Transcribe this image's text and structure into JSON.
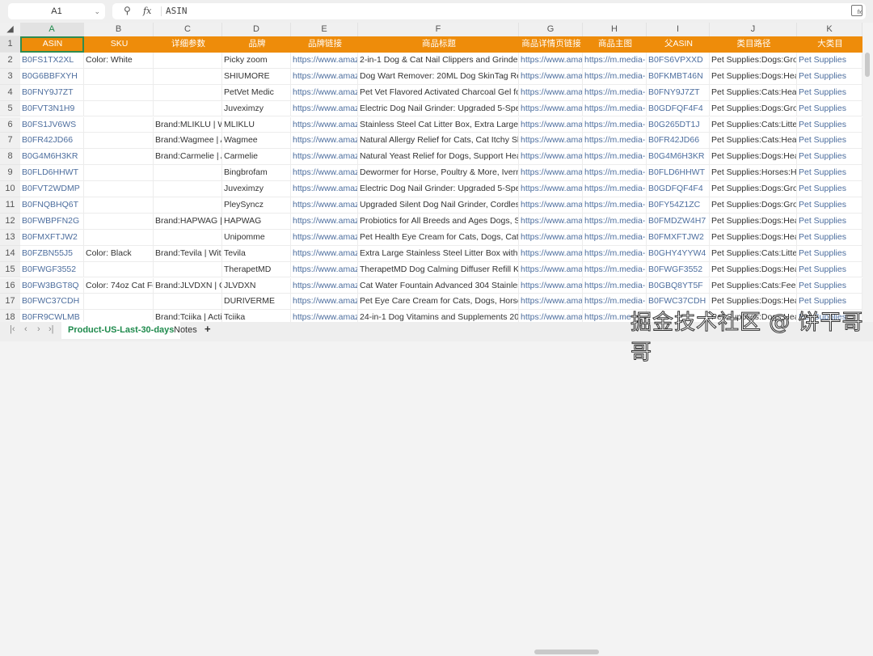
{
  "formula_bar": {
    "name_box": "A1",
    "formula": "ASIN"
  },
  "columns": [
    "A",
    "B",
    "C",
    "D",
    "E",
    "F",
    "G",
    "H",
    "I",
    "J",
    "K"
  ],
  "headers": [
    "ASIN",
    "SKU",
    "详细参数",
    "品牌",
    "品牌链接",
    "商品标题",
    "商品详情页链接",
    "商品主图",
    "父ASIN",
    "类目路径",
    "大类目"
  ],
  "rows": [
    [
      "B0FS1TX2XL",
      "Color: White",
      "",
      "Picky zoom",
      "https://www.amazc",
      "2-in-1 Dog & Cat Nail Clippers and Grinder \\",
      "https://www.ama:",
      "https://m.media-:",
      "B0FS6VPXXD",
      "Pet Supplies:Dogs:Groor",
      "Pet Supplies"
    ],
    [
      "B0G6BBFXYH",
      "",
      "",
      "SHIUMORE",
      "https://www.amazc",
      "Dog Wart Remover: 20ML Dog SkinTag Rem",
      "https://www.ama:",
      "https://m.media-:",
      "B0FKMBT46N",
      "Pet Supplies:Dogs:Healtl",
      "Pet Supplies"
    ],
    [
      "B0FNY9J7ZT",
      "",
      "",
      "PetVet Medic",
      "https://www.amazc",
      "Pet Vet Flavored Activated Charcoal Gel for D",
      "https://www.ama:",
      "https://m.media-:",
      "B0FNY9J7ZT",
      "Pet Supplies:Cats:Health",
      "Pet Supplies"
    ],
    [
      "B0FVT3N1H9",
      "",
      "",
      "Juveximzy",
      "https://www.amazc",
      "Electric Dog Nail Grinder: Upgraded 5-Speec",
      "https://www.ama:",
      "https://m.media-:",
      "B0GDFQF4F4",
      "Pet Supplies:Dogs:Groor",
      "Pet Supplies"
    ],
    [
      "B0FS1JV6WS",
      "",
      "Brand:MLIKLU | Wit",
      "MLIKLU",
      "https://www.amazc",
      "Stainless Steel Cat Litter Box, Extra Large Enc",
      "https://www.ama:",
      "https://m.media-:",
      "B0G265DT1J",
      "Pet Supplies:Cats:Litter &",
      "Pet Supplies"
    ],
    [
      "B0FR42JD66",
      "",
      "Brand:Wagmee | A",
      "Wagmee",
      "https://www.amazc",
      "Natural Allergy Relief for Cats, Cat Itchy Skin",
      "https://www.ama:",
      "https://m.media-:",
      "B0FR42JD66",
      "Pet Supplies:Cats:Health",
      "Pet Supplies"
    ],
    [
      "B0G4M6H3KR",
      "",
      "Brand:Carmelie | Ac",
      "Carmelie",
      "https://www.amazc",
      "Natural Yeast Relief for Dogs, Support Health",
      "https://www.ama:",
      "https://m.media-:",
      "B0G4M6H3KR",
      "Pet Supplies:Dogs:Healtl",
      "Pet Supplies"
    ],
    [
      "B0FLD6HHWT",
      "",
      "",
      "Bingbrofam",
      "https://www.amazc",
      "Dewormer for Horse, Poultry & More, Iverme",
      "https://www.ama:",
      "https://m.media-:",
      "B0FLD6HHWT",
      "Pet Supplies:Horses:Hea",
      "Pet Supplies"
    ],
    [
      "B0FVT2WDMP",
      "",
      "",
      "Juveximzy",
      "https://www.amazc",
      "Electric Dog Nail Grinder: Upgraded 5-Speec",
      "https://www.ama:",
      "https://m.media-:",
      "B0GDFQF4F4",
      "Pet Supplies:Dogs:Groor",
      "Pet Supplies"
    ],
    [
      "B0FNQBHQ6T",
      "",
      "",
      "PleySyncz",
      "https://www.amazc",
      "Upgraded Silent Dog Nail Grinder, Cordless (",
      "https://www.ama:",
      "https://m.media-:",
      "B0FY54Z1ZC",
      "Pet Supplies:Dogs:Groor",
      "Pet Supplies"
    ],
    [
      "B0FWBPFN2G",
      "",
      "Brand:HAPWAG | It",
      "HAPWAG",
      "https://www.amazc",
      "Probiotics for All Breeds and Ages Dogs, Sup",
      "https://www.ama:",
      "https://m.media-:",
      "B0FMDZW4H7",
      "Pet Supplies:Dogs:Healtl",
      "Pet Supplies"
    ],
    [
      "B0FMXFTJW2",
      "",
      "",
      "Unipomme",
      "https://www.amazc",
      "Pet Health Eye Cream for Cats, Dogs, Cattle,",
      "https://www.ama:",
      "https://m.media-:",
      "B0FMXFTJW2",
      "Pet Supplies:Dogs:Healtl",
      "Pet Supplies"
    ],
    [
      "B0FZBN55J5",
      "Color: Black",
      "Brand:Tevila | With",
      "Tevila",
      "https://www.amazc",
      "Extra Large Stainless Steel Litter Box with Lid,",
      "https://www.ama:",
      "https://m.media-:",
      "B0GHY4YYW4",
      "Pet Supplies:Cats:Litter &",
      "Pet Supplies"
    ],
    [
      "B0FWGF3552",
      "",
      "",
      "TherapetMD",
      "https://www.amazc",
      "TherapetMD Dog Calming Diffuser Refill Kit (",
      "https://www.ama:",
      "https://m.media-:",
      "B0FWGF3552",
      "Pet Supplies:Dogs:Healtl",
      "Pet Supplies"
    ],
    [
      "B0FW3BGT8Q",
      "Color: 74oz Cat Fou",
      "Brand:JLVDXN | Ca",
      "JLVDXN",
      "https://www.amazc",
      "Cat Water Fountain Advanced 304 Stainless S",
      "https://www.ama:",
      "https://m.media-:",
      "B0GBQ8YT5F",
      "Pet Supplies:Cats:Feedin",
      "Pet Supplies"
    ],
    [
      "B0FWC37CDH",
      "",
      "",
      "DURIVERME",
      "https://www.amazc",
      "Pet Eye Care Cream for Cats, Dogs, Horses &",
      "https://www.ama:",
      "https://m.media-:",
      "B0FWC37CDH",
      "Pet Supplies:Dogs:Healtl",
      "Pet Supplies"
    ],
    [
      "B0FR9CWLMB",
      "",
      "Brand:Tciika | Activ",
      "Tciika",
      "https://www.amazc",
      "24-in-1 Dog Vitamins and Supplements 200",
      "https://www.ama:",
      "https://m.me",
      "",
      "Pet Supplies:Dogs:Healtl",
      "Pet Supplies"
    ]
  ],
  "link_columns": [
    0,
    4,
    6,
    7,
    8,
    10
  ],
  "sheet_tabs": [
    {
      "label": "Product-US-Last-30-days",
      "active": true
    },
    {
      "label": "Notes",
      "active": false
    }
  ],
  "add_sheet": "+",
  "overlay_text": "掘金技术社区 @ 饼干哥哥",
  "colors": {
    "header_fill": "#ee8c0a",
    "header_text": "#ffffff",
    "link_text": "#4d6e9e",
    "active_tab": "#1e8a4c"
  }
}
